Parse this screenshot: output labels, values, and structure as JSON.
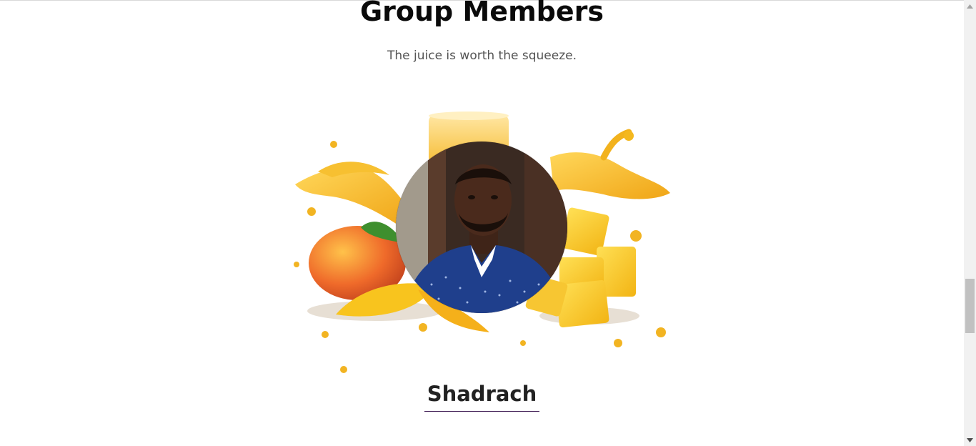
{
  "section": {
    "title": "Group Members",
    "subtitle": "The juice is worth the squeeze."
  },
  "member": {
    "name": "Shadrach",
    "image_icon": "member-portrait",
    "background_icon": "mango-juice-splash"
  },
  "colors": {
    "title": "#0a0a0a",
    "subtitle": "#555555",
    "name": "#222222",
    "underline": "#3a1650",
    "mango": "#f3b81e",
    "shirt": "#1f3f8c"
  }
}
